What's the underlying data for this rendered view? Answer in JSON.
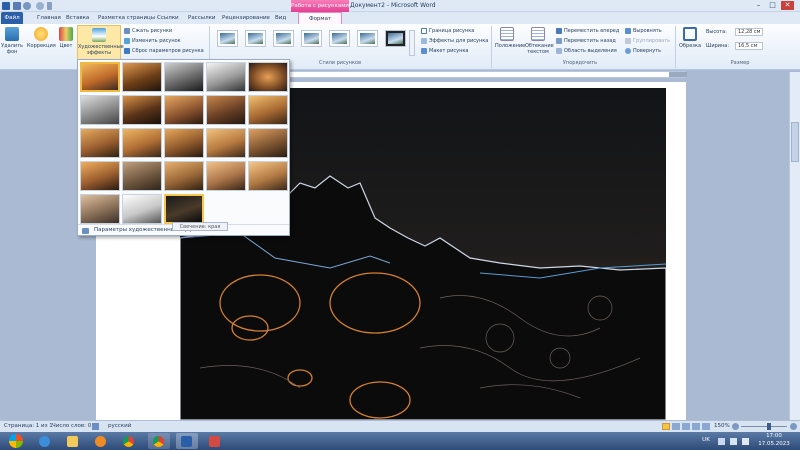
{
  "window": {
    "title": "Документ2 - Microsoft Word",
    "context_tools": "Работа с рисунками",
    "controls": {
      "minimize": "–",
      "maximize": "□",
      "close": "✕"
    }
  },
  "tabs": [
    "Файл",
    "Главная",
    "Вставка",
    "Разметка страницы",
    "Ссылки",
    "Рассылки",
    "Рецензирование",
    "Вид",
    "Формат"
  ],
  "ribbon": {
    "remove_bg": "Удалить фон",
    "corrections": "Коррекция",
    "color": "Цвет",
    "artistic_effects": "Художественные эффекты",
    "compress": "Сжать рисунки",
    "change_picture": "Изменить рисунок",
    "reset_picture": "Сброс параметров рисунка",
    "picture_styles_label": "Стили рисунков",
    "border": "Граница рисунка",
    "effects": "Эффекты для рисунка",
    "layout": "Макет рисунка",
    "position": "Положение",
    "wrap_text": "Обтекание текстом",
    "bring_forward": "Переместить вперед",
    "send_backward": "Переместить назад",
    "selection_pane": "Область выделения",
    "align": "Выровнять",
    "group": "Группировать",
    "rotate": "Повернуть",
    "arrange_label": "Упорядочить",
    "crop": "Обрезка",
    "height_label": "Высота:",
    "height_value": "12,28 см",
    "width_label": "Ширина:",
    "width_value": "16,5 см",
    "size_label": "Размер"
  },
  "gallery": {
    "footer": "Параметры художественных эффектов...",
    "tooltip": "Свечение: края"
  },
  "status": {
    "page": "Страница: 1 из 1",
    "words": "Число слов: 0",
    "lang": "русский",
    "zoom": "150%",
    "zoom_fraction": 0.62
  },
  "taskbar": {
    "lang": "UK",
    "time": "17:00",
    "date": "17.05.2023"
  },
  "colors": {
    "ribbon_accent": "#2a5ea8",
    "context_pink": "#e43e93",
    "selection_gold": "#f1b93f"
  }
}
